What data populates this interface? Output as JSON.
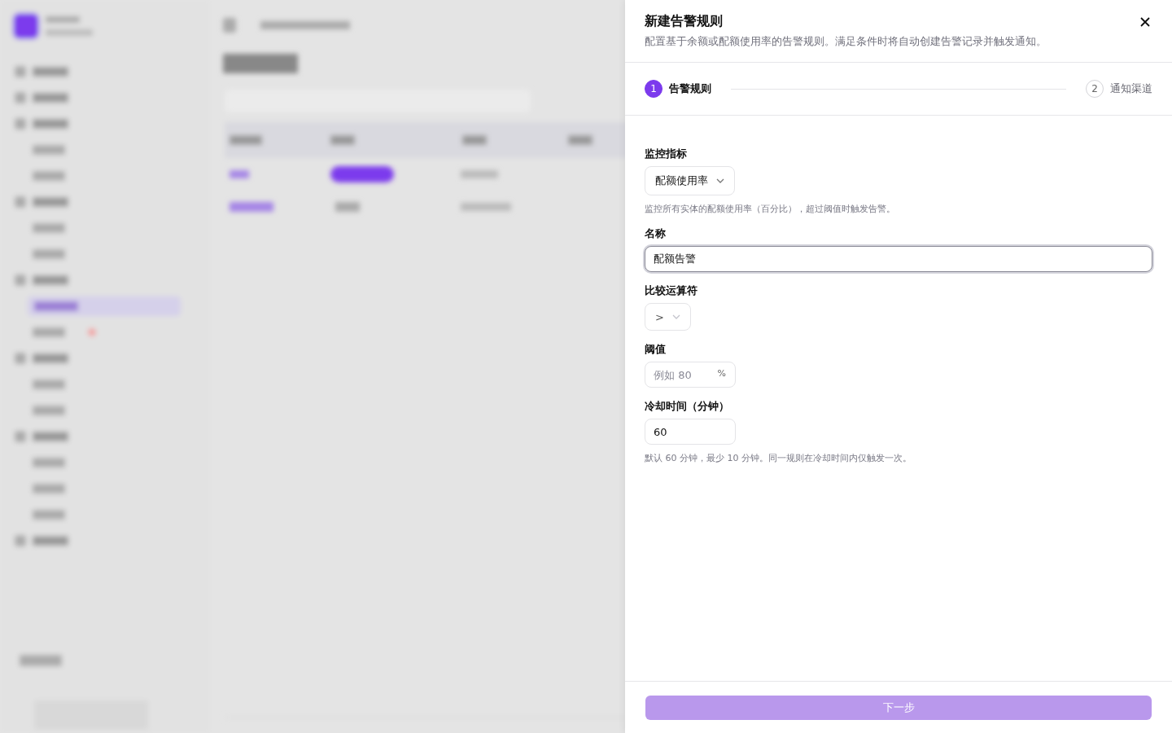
{
  "drawer": {
    "title": "新建告警规则",
    "description": "配置基于余额或配额使用率的告警规则。满足条件时将自动创建告警记录并触发通知。"
  },
  "steps": [
    {
      "number": "1",
      "label": "告警规则",
      "selected": true
    },
    {
      "number": "2",
      "label": "通知渠道",
      "selected": false
    }
  ],
  "fields": [
    {
      "kind": "select",
      "label": "监控指标",
      "value": "配额使用率",
      "disabled": false,
      "hint": "监控所有实体的配额使用率（百分比），超过阈值时触发告警。"
    },
    {
      "kind": "text",
      "label": "名称",
      "value": "配额告警",
      "focused": true
    },
    {
      "kind": "select",
      "label": "比较运算符",
      "value": ">",
      "disabled": true
    },
    {
      "kind": "number",
      "label": "阈值",
      "placeholder": "例如 80",
      "unit": "%"
    },
    {
      "kind": "number",
      "label": "冷却时间（分钟）",
      "value": "60",
      "hint": "默认 60 分钟，最少 10 分钟。同一规则在冷却时间内仅触发一次。"
    }
  ],
  "next_button": {
    "label": "下一步",
    "disabled": true
  }
}
